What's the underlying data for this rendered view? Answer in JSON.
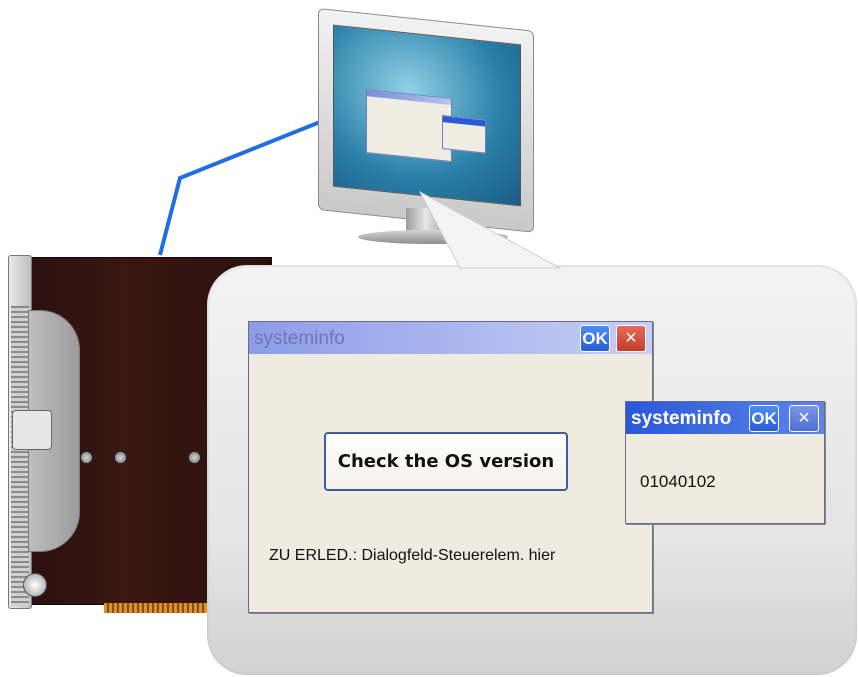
{
  "main_dialog": {
    "title": "systeminfo",
    "ok_label": "OK",
    "close_label": "×",
    "button_label": "Check the OS version",
    "todo_text": "ZU ERLED.: Dialogfeld-Steuerelem. hier"
  },
  "sub_dialog": {
    "title": "systeminfo",
    "ok_label": "OK",
    "close_label": "×",
    "value_text": "01040102"
  },
  "colors": {
    "cable": "#1f6fe0",
    "device_body": "#2a1010",
    "titlebar_active": "#2a58d8",
    "titlebar_inactive": "#8e9ce8",
    "dialog_bg": "#efebe0"
  },
  "icons": [
    "close-icon",
    "ok-icon",
    "screw-icon"
  ]
}
